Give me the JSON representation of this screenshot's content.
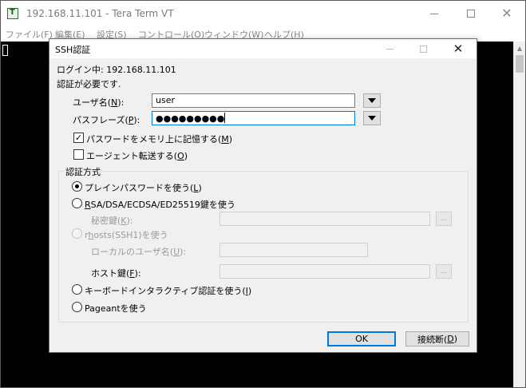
{
  "main_window": {
    "title": "192.168.11.101 - Tera Term VT",
    "menu": [
      "ファイル(F)",
      "編集(E)",
      "設定(S)",
      "コントロール(O)",
      "ウィンドウ(W)",
      "ヘルプ(H)"
    ]
  },
  "dialog": {
    "title": "SSH認証",
    "login_label": "ログイン中:",
    "login_host": "192.168.11.101",
    "auth_required": "認証が必要です.",
    "username_label_pre": "ユーザ名(",
    "username_key": "N",
    "username_label_post": "):",
    "username_value": "user",
    "passphrase_label_pre": "パスフレーズ(",
    "passphrase_key": "P",
    "passphrase_label_post": "):",
    "passphrase_value": "●●●●●●●●●",
    "remember_pre": "パスワードをメモリ上に記憶する(",
    "remember_key": "M",
    "remember_post": ")",
    "remember_checked": true,
    "agent_pre": "エージェント転送する(",
    "agent_key": "O",
    "agent_post": ")",
    "agent_checked": false,
    "method_group": "認証方式",
    "plain_pre": "プレインパスワードを使う(",
    "plain_key": "L",
    "plain_post": ")",
    "rsa_key": "R",
    "rsa_post": "SA/DSA/ECDSA/ED25519鍵を使う",
    "privkey_pre": "秘密鍵(",
    "privkey_key": "K",
    "privkey_post": "):",
    "browse_label": "...",
    "rhosts_pre": "r",
    "rhosts_key": "h",
    "rhosts_post": "osts(SSH1)を使う",
    "local_user_pre": "ローカルのユーザ名(",
    "local_user_key": "U",
    "local_user_post": "):",
    "hostkey_pre": "ホスト鍵(",
    "hostkey_key": "F",
    "hostkey_post": "):",
    "keyboard_pre": "キーボードインタラクティブ認証を使う(",
    "keyboard_key": "I",
    "keyboard_post": ")",
    "pageant_label": "Pageantを使う",
    "ok_label": "OK",
    "disconnect_pre": "接続断(",
    "disconnect_key": "D",
    "disconnect_post": ")"
  },
  "colors": {
    "focus_accent": "#0078d7",
    "terminal_bg": "#000000"
  }
}
